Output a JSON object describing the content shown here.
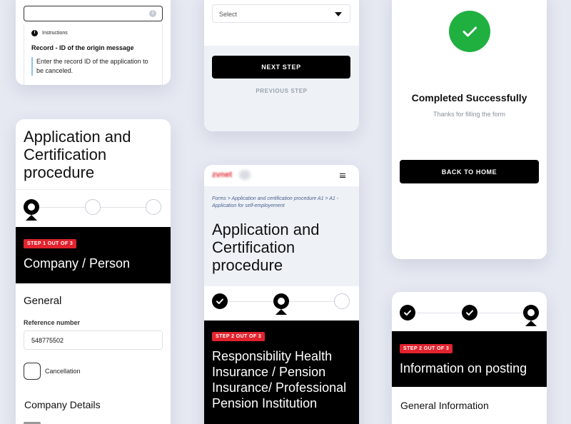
{
  "card_instructions": {
    "info_icon": "info-icon",
    "label": "Instructions",
    "record_title": "Record - ID of the origin message",
    "record_text": "Enter the record ID of the application to be canceled."
  },
  "card_select": {
    "select_value": "Select",
    "next_button": "NEXT STEP",
    "previous_button": "PREVIOUS STEP"
  },
  "card_success": {
    "title": "Completed Successfully",
    "subtitle": "Thanks for filling the form",
    "button": "BACK TO HOME",
    "accent": "#1fb040"
  },
  "card_application": {
    "title": "Application and Certification procedure",
    "badge": "STEP 1 OUT OF 3",
    "step_title": "Company / Person",
    "section_general": "General",
    "reference_label": "Reference number",
    "reference_value": "548775502",
    "cancellation_label": "Cancellation",
    "section_company": "Company Details",
    "steps": [
      "active",
      "empty",
      "empty"
    ]
  },
  "card_mobile": {
    "logo": "zvnet",
    "menu_icon": "hamburger-icon",
    "breadcrumb": "Forms > Application and certification procedure A1 > A1 - Application for self-employement",
    "title": "Application and Certification procedure",
    "badge": "STEP 2 OUT OF 3",
    "step_title": "Responsibility Health Insurance / Pension Insurance/ Professional Pension Institution",
    "steps": [
      "done",
      "active",
      "empty"
    ]
  },
  "card_posting": {
    "badge": "STEP 2 OUT OF 3",
    "step_title": "Information on posting",
    "section": "General Information",
    "steps": [
      "done",
      "done",
      "active"
    ]
  },
  "colors": {
    "background": "#e6e9f2",
    "badge_red": "#e2232e",
    "breadcrumb_link": "#4a5f8c"
  }
}
